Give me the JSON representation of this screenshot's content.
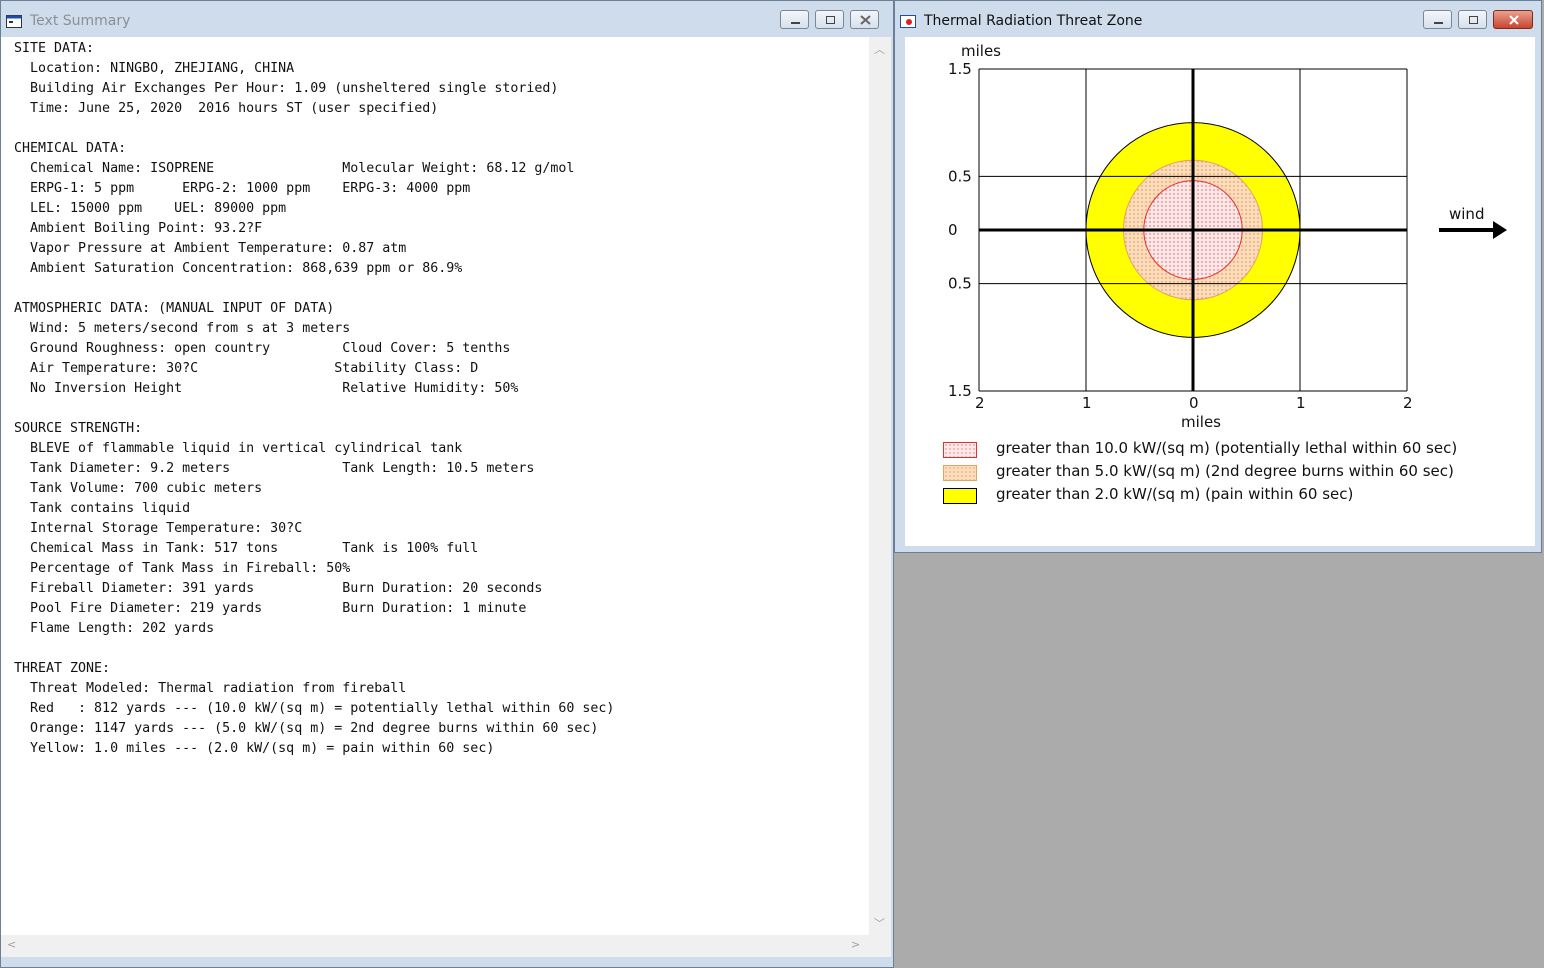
{
  "text_summary": {
    "title": "Text Summary",
    "lines": [
      "SITE DATA:",
      "  Location: NINGBO, ZHEJIANG, CHINA",
      "  Building Air Exchanges Per Hour: 1.09 (unsheltered single storied)",
      "  Time: June 25, 2020  2016 hours ST (user specified)",
      "",
      "CHEMICAL DATA:",
      "  Chemical Name: ISOPRENE                Molecular Weight: 68.12 g/mol",
      "  ERPG-1: 5 ppm      ERPG-2: 1000 ppm    ERPG-3: 4000 ppm",
      "  LEL: 15000 ppm    UEL: 89000 ppm",
      "  Ambient Boiling Point: 93.2?F",
      "  Vapor Pressure at Ambient Temperature: 0.87 atm",
      "  Ambient Saturation Concentration: 868,639 ppm or 86.9%",
      "",
      "ATMOSPHERIC DATA: (MANUAL INPUT OF DATA)",
      "  Wind: 5 meters/second from s at 3 meters",
      "  Ground Roughness: open country         Cloud Cover: 5 tenths",
      "  Air Temperature: 30?C                 Stability Class: D",
      "  No Inversion Height                    Relative Humidity: 50%",
      "",
      "SOURCE STRENGTH:",
      "  BLEVE of flammable liquid in vertical cylindrical tank",
      "  Tank Diameter: 9.2 meters              Tank Length: 10.5 meters",
      "  Tank Volume: 700 cubic meters",
      "  Tank contains liquid",
      "  Internal Storage Temperature: 30?C",
      "  Chemical Mass in Tank: 517 tons        Tank is 100% full",
      "  Percentage of Tank Mass in Fireball: 50%",
      "  Fireball Diameter: 391 yards           Burn Duration: 20 seconds",
      "  Pool Fire Diameter: 219 yards          Burn Duration: 1 minute",
      "  Flame Length: 202 yards",
      "",
      "THREAT ZONE:",
      "  Threat Modeled: Thermal radiation from fireball",
      "  Red   : 812 yards --- (10.0 kW/(sq m) = potentially lethal within 60 sec)",
      "  Orange: 1147 yards --- (5.0 kW/(sq m) = 2nd degree burns within 60 sec)",
      "  Yellow: 1.0 miles --- (2.0 kW/(sq m) = pain within 60 sec)"
    ]
  },
  "threat_zone": {
    "title": "Thermal Radiation Threat Zone",
    "y_unit_label": "miles",
    "x_unit_label": "miles",
    "wind_label": "wind",
    "y_tick_labels": [
      "1.5",
      "0.5",
      "0",
      "0.5",
      "1.5"
    ],
    "x_tick_labels": [
      "2",
      "1",
      "0",
      "1",
      "2"
    ],
    "legend": [
      {
        "label": "greater than 10.0 kW/(sq m) (potentially lethal within 60 sec)",
        "fill": "#fbe3e3",
        "border": "#e53030"
      },
      {
        "label": "greater than 5.0 kW/(sq m) (2nd degree burns within 60 sec)",
        "fill": "#fbdcbc",
        "border": "#e8a060"
      },
      {
        "label": "greater than 2.0 kW/(sq m) (pain within 60 sec)",
        "fill": "#ffff00",
        "border": "#000000"
      }
    ]
  },
  "chart_data": {
    "type": "area",
    "xlabel": "miles",
    "ylabel": "miles",
    "xlim": [
      -2,
      2
    ],
    "ylim": [
      -1.5,
      1.5
    ],
    "x_tick_values": [
      -2,
      -1,
      0,
      1,
      2
    ],
    "y_tick_values": [
      1.5,
      0.5,
      0,
      -0.5,
      -1.5
    ],
    "grid": true,
    "wind_direction": "east",
    "zones": [
      {
        "name": "greater than 2.0 kW/(sq m) (pain within 60 sec)",
        "radius_miles": 1.0,
        "color": "#ffff00"
      },
      {
        "name": "greater than 5.0 kW/(sq m) (2nd degree burns within 60 sec)",
        "radius_miles": 0.65,
        "color": "#fbdcbc"
      },
      {
        "name": "greater than 10.0 kW/(sq m) (potentially lethal within 60 sec)",
        "radius_miles": 0.46,
        "color": "#fbe3e3"
      }
    ]
  }
}
